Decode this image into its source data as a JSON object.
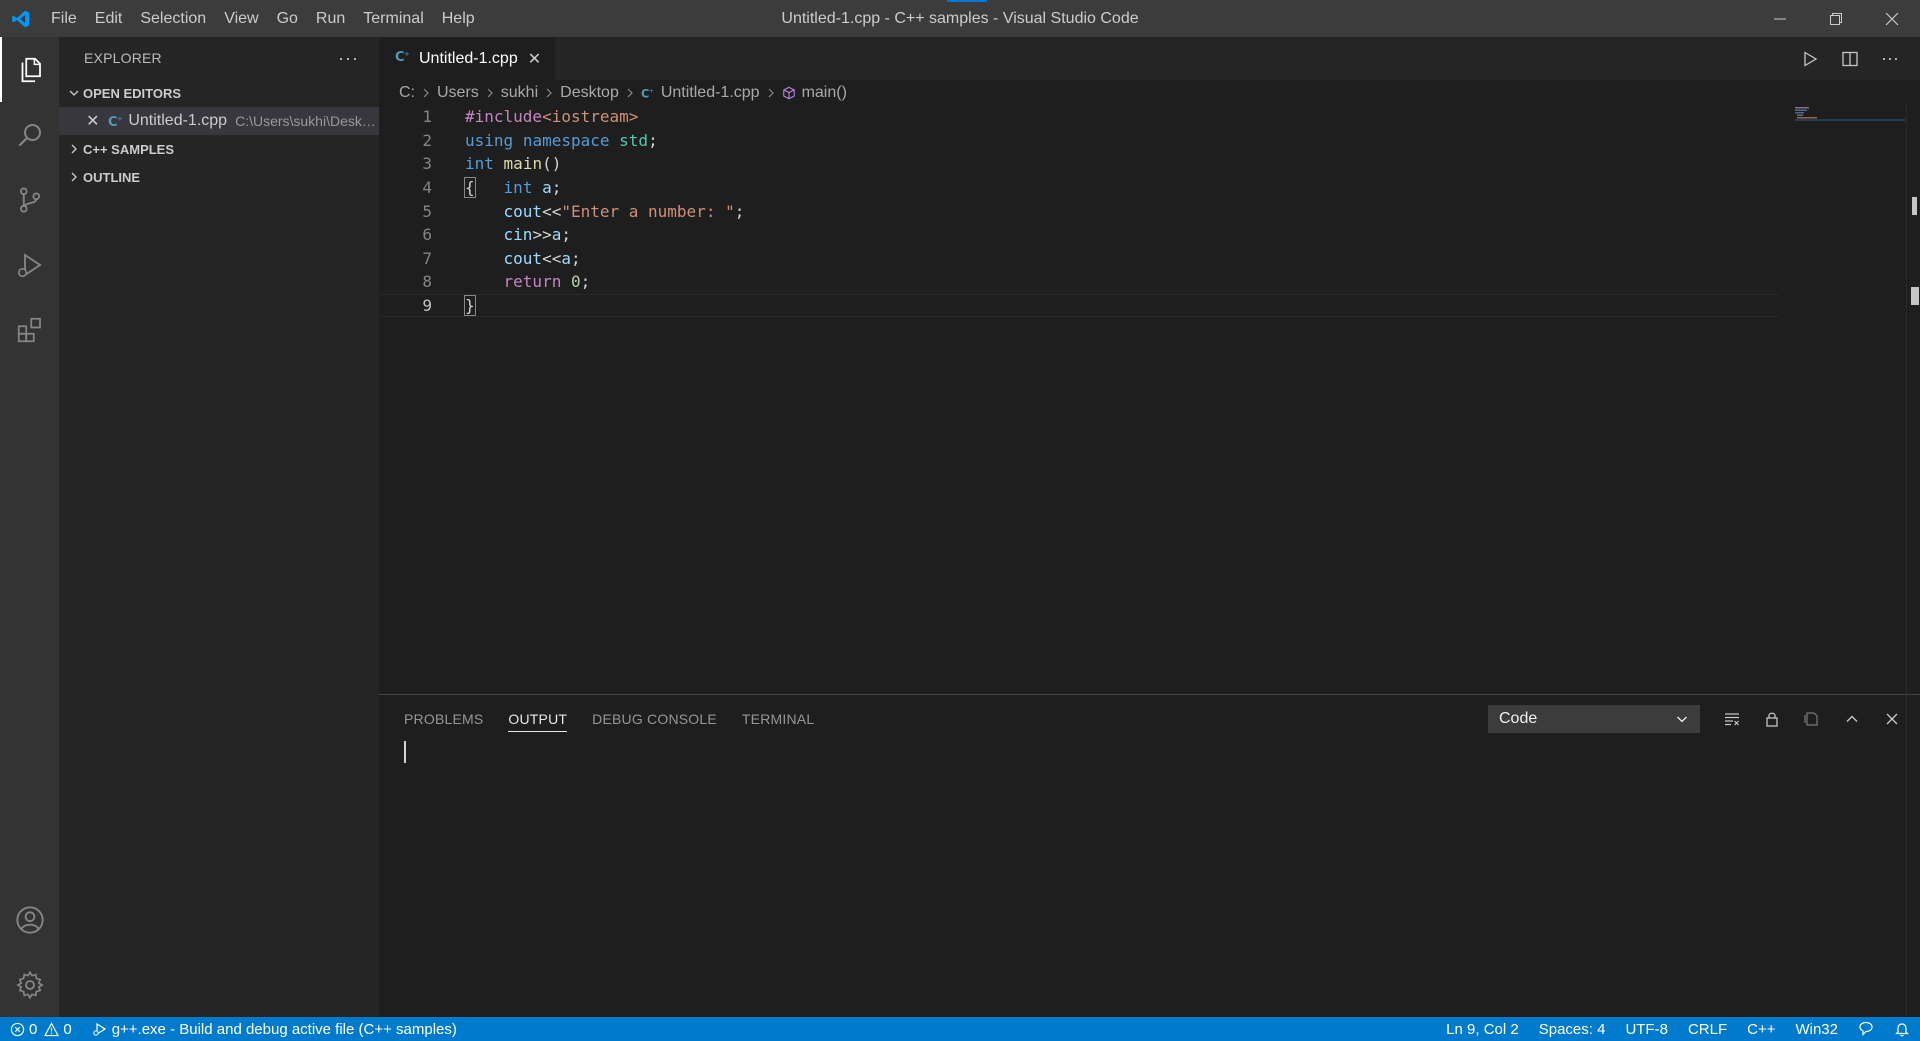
{
  "window": {
    "title": "Untitled-1.cpp - C++ samples - Visual Studio Code",
    "menu": [
      "File",
      "Edit",
      "Selection",
      "View",
      "Go",
      "Run",
      "Terminal",
      "Help"
    ]
  },
  "sidebar": {
    "header": "EXPLORER",
    "sections": {
      "open_editors": "OPEN EDITORS",
      "workspace": "C++ SAMPLES",
      "outline": "OUTLINE"
    },
    "open_file": {
      "name": "Untitled-1.cpp",
      "path": "C:\\Users\\sukhi\\Desktop"
    }
  },
  "editor": {
    "tab_label": "Untitled-1.cpp",
    "breadcrumb": [
      "C:",
      "Users",
      "sukhi",
      "Desktop",
      "Untitled-1.cpp",
      "main()"
    ],
    "line_numbers": [
      "1",
      "2",
      "3",
      "4",
      "5",
      "6",
      "7",
      "8",
      "9"
    ]
  },
  "panel": {
    "tabs": [
      "PROBLEMS",
      "OUTPUT",
      "DEBUG CONSOLE",
      "TERMINAL"
    ],
    "active_tab": "OUTPUT",
    "output_channel": "Code"
  },
  "statusbar": {
    "errors": "0",
    "warnings": "0",
    "build_task": "g++.exe - Build and debug active file (C++ samples)",
    "cursor": "Ln 9, Col 2",
    "spaces": "Spaces: 4",
    "encoding": "UTF-8",
    "eol": "CRLF",
    "language": "C++",
    "platform": "Win32"
  },
  "colors": {
    "accent": "#007acc",
    "keyword": "#569cd6",
    "control": "#c586c0",
    "function": "#dcdcaa",
    "string": "#ce9178",
    "number": "#b5cea8",
    "namespace": "#4ec9b0",
    "variable": "#9cdcfe"
  },
  "icons": {
    "logo": "vscode-logo-icon",
    "activity": [
      "explorer-icon",
      "search-icon",
      "source-control-icon",
      "run-debug-icon",
      "extensions-icon"
    ],
    "activity_bottom": [
      "account-icon",
      "gear-icon"
    ]
  }
}
